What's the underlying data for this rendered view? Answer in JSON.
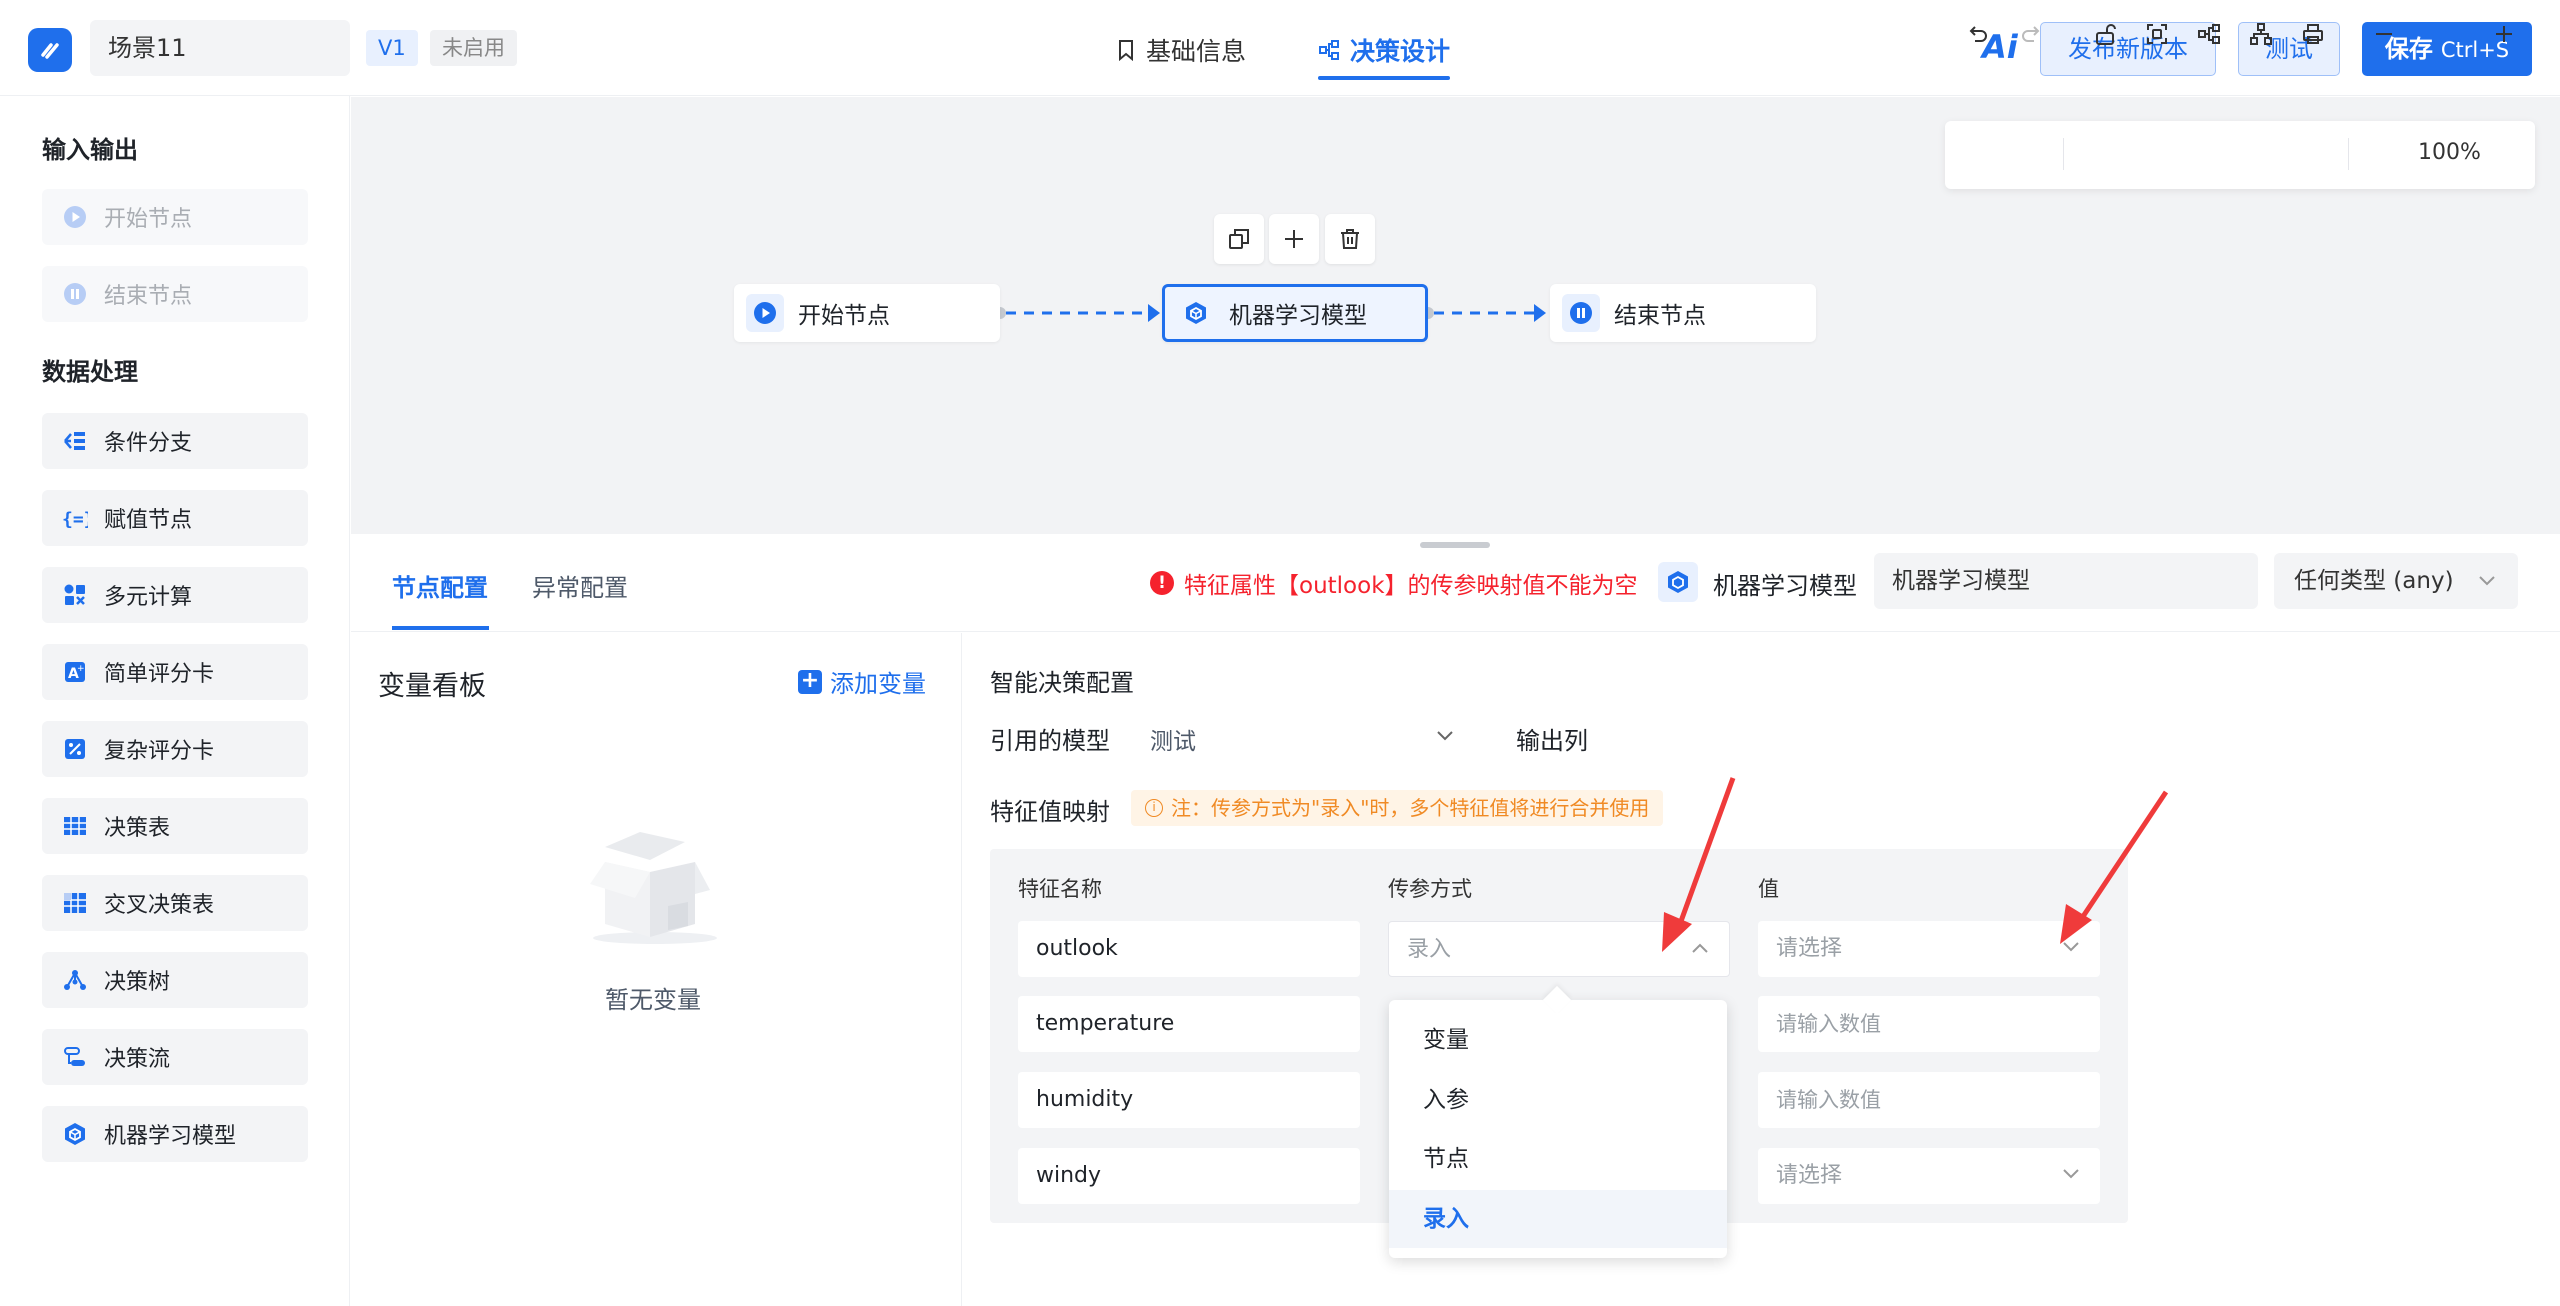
{
  "header": {
    "scene_name": "场景11",
    "version": "V1",
    "status": "未启用",
    "tabs": [
      {
        "label": "基础信息",
        "icon": "bookmark-icon"
      },
      {
        "label": "决策设计",
        "icon": "flow-icon"
      }
    ],
    "ai_label": "Ai",
    "publish_label": "发布新版本",
    "test_label": "测试",
    "save_label": "保存",
    "save_shortcut": "Ctrl+S"
  },
  "sidebar": {
    "group1": "输入输出",
    "group1_items": [
      {
        "label": "开始节点",
        "icon": "play-icon"
      },
      {
        "label": "结束节点",
        "icon": "pause-icon"
      }
    ],
    "group2": "数据处理",
    "group2_items": [
      {
        "label": "条件分支",
        "icon": "branch-icon"
      },
      {
        "label": "赋值节点",
        "icon": "assign-icon"
      },
      {
        "label": "多元计算",
        "icon": "calc-icon"
      },
      {
        "label": "简单评分卡",
        "icon": "scorecard-icon"
      },
      {
        "label": "复杂评分卡",
        "icon": "complex-scorecard-icon"
      },
      {
        "label": "决策表",
        "icon": "table-icon"
      },
      {
        "label": "交叉决策表",
        "icon": "cross-table-icon"
      },
      {
        "label": "决策树",
        "icon": "tree-icon"
      },
      {
        "label": "决策流",
        "icon": "flow-icon"
      },
      {
        "label": "机器学习模型",
        "icon": "cube-icon"
      }
    ]
  },
  "canvas": {
    "zoom": "100%",
    "nodes": [
      {
        "label": "开始节点",
        "icon": "play-icon"
      },
      {
        "label": "机器学习模型",
        "icon": "cube-icon"
      },
      {
        "label": "结束节点",
        "icon": "pause-icon"
      }
    ]
  },
  "panel": {
    "tabs": [
      "节点配置",
      "异常配置"
    ],
    "error": "特征属性【outlook】的传参映射值不能为空",
    "model_label": "机器学习模型",
    "model_name": "机器学习模型",
    "type_select": "任何类型 (any)"
  },
  "var_board": {
    "title": "变量看板",
    "add_label": "添加变量",
    "empty_text": "暂无变量"
  },
  "config": {
    "title": "智能决策配置",
    "model_label": "引用的模型",
    "model_value": "测试",
    "output_label": "输出列",
    "mapping_label": "特征值映射",
    "note": "注：传参方式为\"录入\"时，多个特征值将进行合并使用",
    "columns": [
      "特征名称",
      "传参方式",
      "值"
    ],
    "rows": [
      {
        "feature": "outlook",
        "method_placeholder": "录入",
        "value_placeholder": "请选择"
      },
      {
        "feature": "temperature",
        "value_placeholder": "请输入数值"
      },
      {
        "feature": "humidity",
        "value_placeholder": "请输入数值"
      },
      {
        "feature": "windy",
        "value_placeholder": "请选择"
      }
    ],
    "dropdown_options": [
      "变量",
      "入参",
      "节点",
      "录入"
    ],
    "dropdown_selected": "录入"
  },
  "colors": {
    "accent": "#1f6fec",
    "error": "#f5222d",
    "warning": "#f08a24",
    "annotation": "#ef3b3b"
  }
}
